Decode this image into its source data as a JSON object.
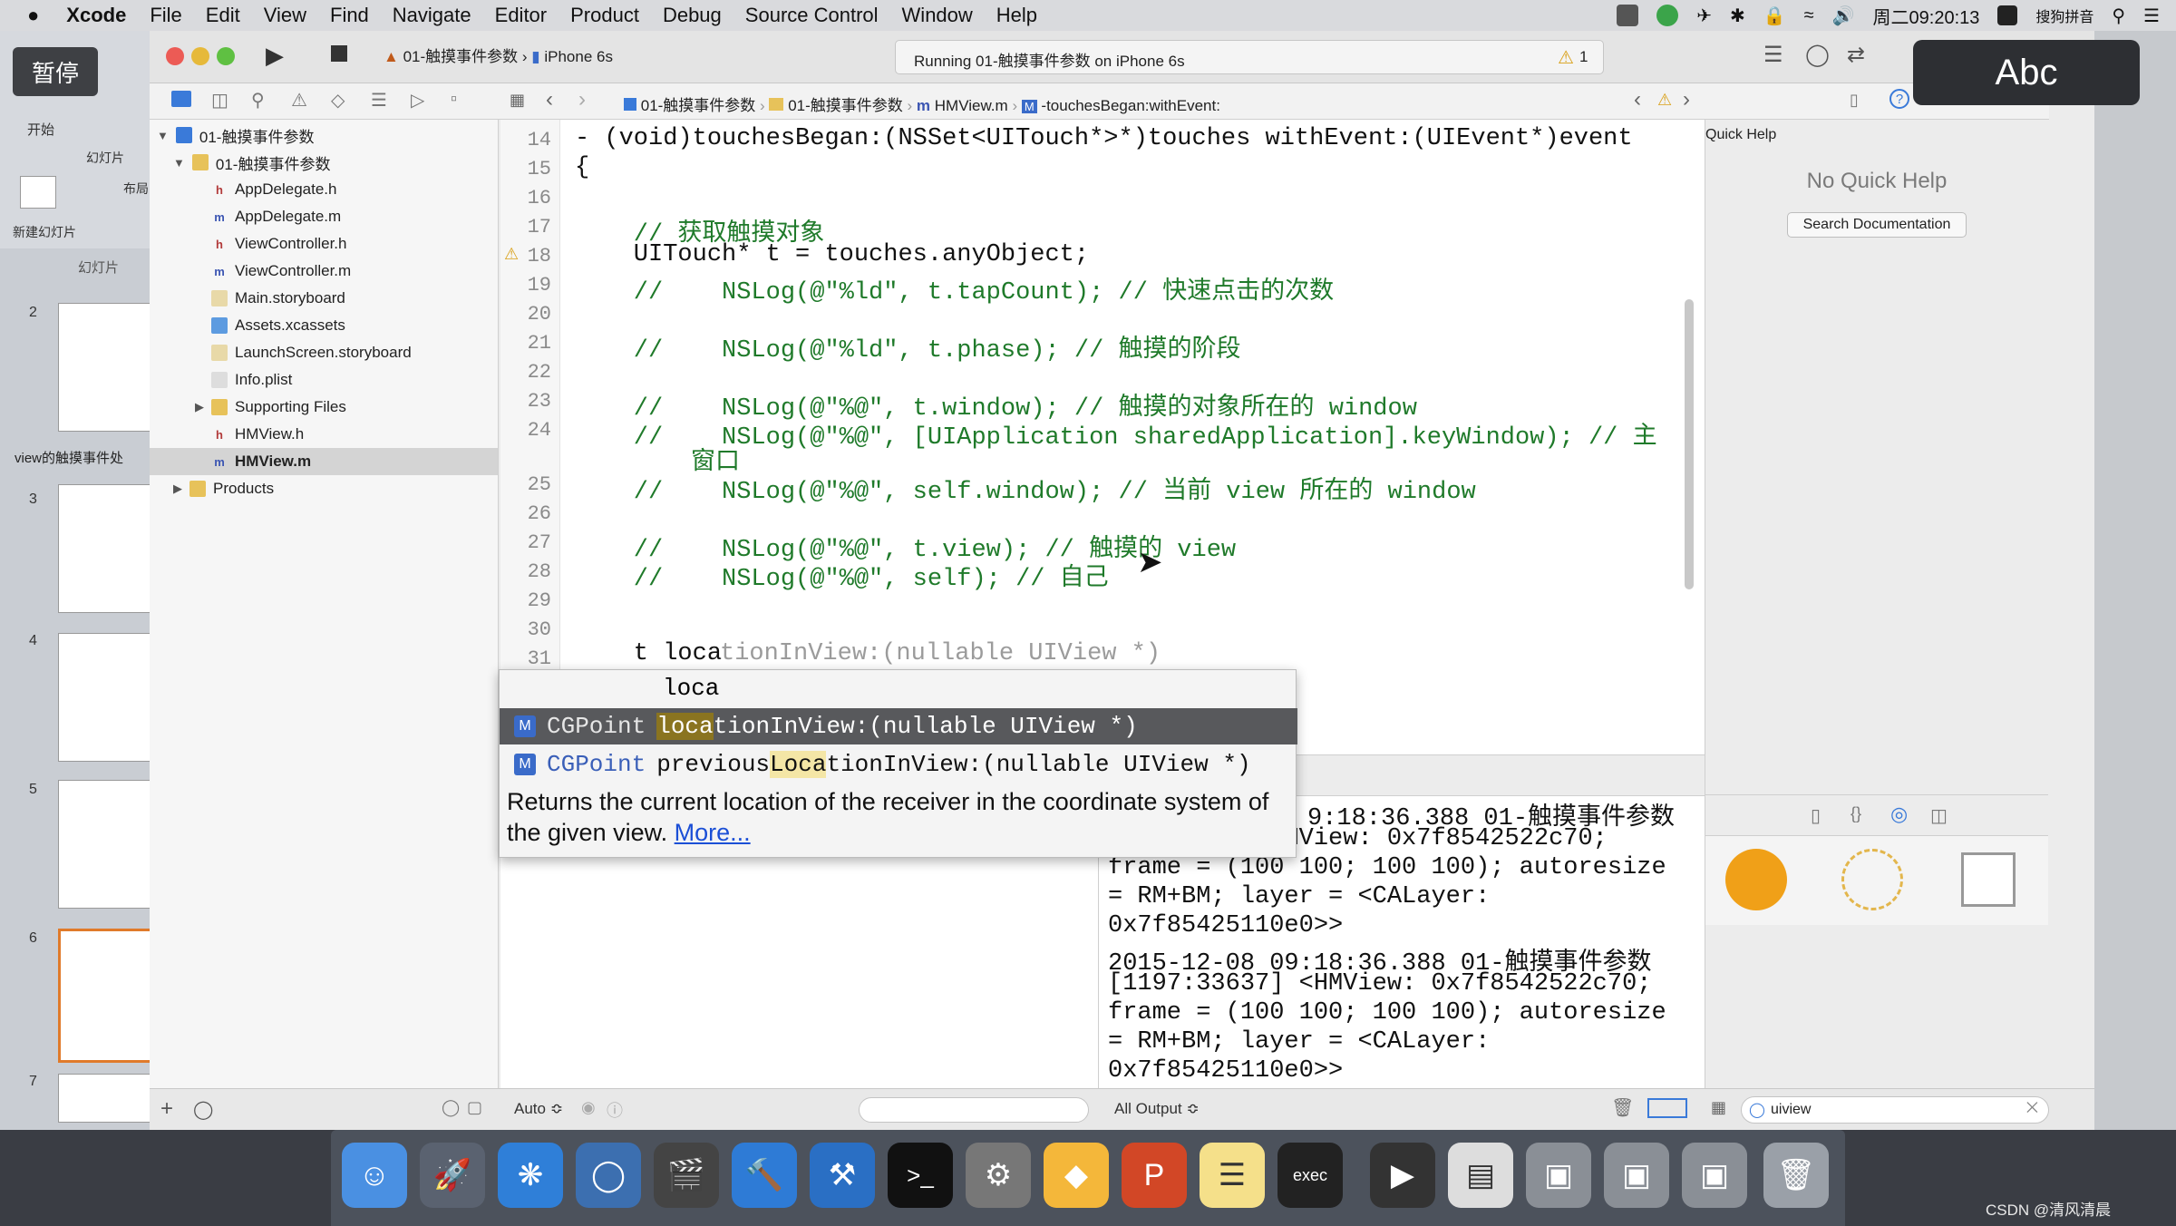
{
  "menubar": {
    "apple": "",
    "app_name": "Xcode",
    "menus": [
      "File",
      "Edit",
      "View",
      "Find",
      "Navigate",
      "Editor",
      "Product",
      "Debug",
      "Source Control",
      "Window",
      "Help"
    ],
    "clock": "周二09:20:13",
    "ime": "搜狗拼音"
  },
  "ppt": {
    "pause_label": "暂停",
    "start_tab": "开始",
    "slide_label": "幻灯片",
    "new_slide": "新建幻灯片",
    "layout": "布局",
    "section_label": "幻灯片",
    "section_title": "view的触摸事件处",
    "slide_numbers": [
      "2",
      "3",
      "4",
      "5",
      "6",
      "7"
    ]
  },
  "toolbar": {
    "scheme": "01-触摸事件参数",
    "device": "iPhone 6s",
    "status": "Running 01-触摸事件参数 on iPhone 6s",
    "warning_count": "1"
  },
  "jumpbar": {
    "items": [
      "01-触摸事件参数",
      "01-触摸事件参数",
      "HMView.m",
      "-touchesBegan:withEvent:"
    ]
  },
  "navigator": {
    "project": "01-触摸事件参数",
    "group": "01-触摸事件参数",
    "files": [
      {
        "name": "AppDelegate.h",
        "type": "h"
      },
      {
        "name": "AppDelegate.m",
        "type": "m"
      },
      {
        "name": "ViewController.h",
        "type": "h"
      },
      {
        "name": "ViewController.m",
        "type": "m"
      },
      {
        "name": "Main.storyboard",
        "type": "sb"
      },
      {
        "name": "Assets.xcassets",
        "type": "folder"
      },
      {
        "name": "LaunchScreen.storyboard",
        "type": "sb"
      },
      {
        "name": "Info.plist",
        "type": "plist"
      },
      {
        "name": "Supporting Files",
        "type": "folder"
      },
      {
        "name": "HMView.h",
        "type": "h"
      },
      {
        "name": "HMView.m",
        "type": "m"
      }
    ],
    "products": "Products"
  },
  "editor": {
    "line_numbers": [
      "14",
      "15",
      "16",
      "17",
      "18",
      "19",
      "20",
      "21",
      "22",
      "23",
      "24",
      "25",
      "26",
      "27",
      "28",
      "29",
      "30",
      "31"
    ],
    "lines": [
      "- (void)touchesBegan:(NSSet<UITouch*>*)touches withEvent:(UIEvent*)event",
      "{",
      "",
      "    // 获取触摸对象",
      "    UITouch* t = touches.anyObject;",
      "    //    NSLog(@\"%ld\", t.tapCount); // 快速点击的次数",
      "",
      "    //    NSLog(@\"%ld\", t.phase); // 触摸的阶段",
      "",
      "    //    NSLog(@\"%@\", t.window); // 触摸的对象所在的 window",
      "    //    NSLog(@\"%@\", [UIApplication sharedApplication].keyWindow); // 主",
      "窗口",
      "    //    NSLog(@\"%@\", self.window); // 当前 view 所在的 window",
      "",
      "    //    NSLog(@\"%@\", t.view); // 触摸的 view",
      "    //    NSLog(@\"%@\", self); // 自己",
      "",
      "",
      "    t loca",
      "tionInView:(nullable UIView *)"
    ]
  },
  "autocomplete": {
    "typed": "loca",
    "items": [
      {
        "badge": "M",
        "ret": "CGPoint",
        "pre": "",
        "match": "loca",
        "post": "tionInView:(nullable UIView *)"
      },
      {
        "badge": "M",
        "ret": "CGPoint",
        "pre": "previous",
        "match": "Loca",
        "post": "tionInView:(nullable UIView *)"
      }
    ],
    "description": "Returns the current location of the receiver in the coordinate system of the given view.",
    "more_link": "More..."
  },
  "console": {
    "lines": [
      "9:18:36.388 01-触摸事件参数",
      "          <HMView: 0x7f8542522c70;",
      "frame = (100 100; 100 100); autoresize",
      "= RM+BM; layer = <CALayer:",
      "0x7f85425110e0>>",
      "2015-12-08 09:18:36.388 01-触摸事件参数",
      "[1197:33637] <HMView: 0x7f8542522c70;",
      "frame = (100 100; 100 100); autoresize",
      "= RM+BM; layer = <CALayer:",
      "0x7f85425110e0>>"
    ]
  },
  "inspector": {
    "section_title": "Quick Help",
    "no_help": "No Quick Help",
    "search_button": "Search Documentation",
    "filter_value": "uiview"
  },
  "bottombar": {
    "auto_label": "Auto ≎",
    "output_label": "All Output ≎"
  },
  "overlay": {
    "abc": "Abc",
    "watermark": "CSDN @清风清晨"
  }
}
